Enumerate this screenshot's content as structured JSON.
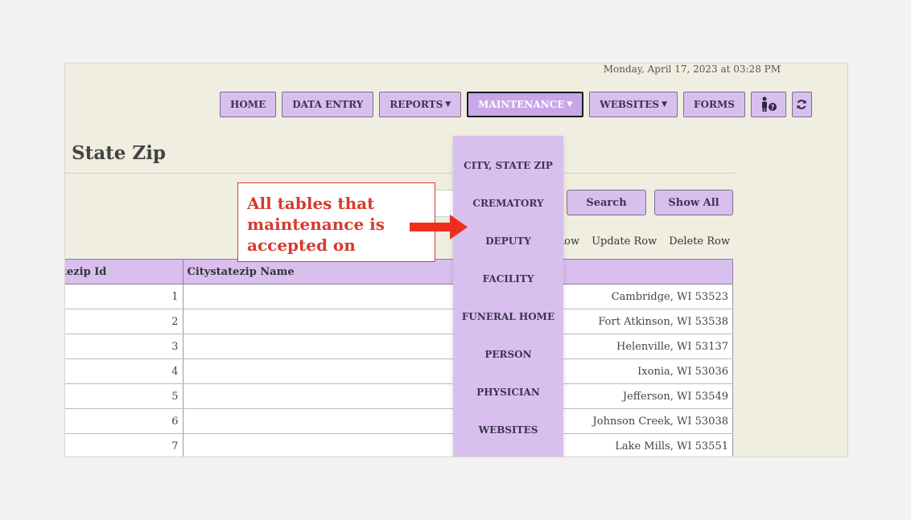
{
  "datetime": "Monday, April 17, 2023 at 03:28 PM",
  "nav": {
    "home": "HOME",
    "data_entry": "DATA ENTRY",
    "reports": "REPORTS",
    "maintenance": "MAINTENANCE",
    "websites": "WEBSITES",
    "forms": "FORMS",
    "help_icon": "person-help-icon",
    "refresh_icon": "refresh-icon",
    "caret_icon": "caret-down-icon"
  },
  "page": {
    "title": "State Zip"
  },
  "buttons": {
    "search": "Search",
    "show_all": "Show All"
  },
  "row_actions": [
    "Row",
    "Update Row",
    "Delete Row"
  ],
  "table": {
    "columns": [
      "tezip Id",
      "Citystatezip Name"
    ],
    "rows": [
      {
        "id": "1",
        "name": "Cambridge, WI 53523"
      },
      {
        "id": "2",
        "name": "Fort Atkinson, WI 53538"
      },
      {
        "id": "3",
        "name": "Helenville, WI 53137"
      },
      {
        "id": "4",
        "name": "Ixonia, WI 53036"
      },
      {
        "id": "5",
        "name": "Jefferson, WI 53549"
      },
      {
        "id": "6",
        "name": "Johnson Creek, WI 53038"
      },
      {
        "id": "7",
        "name": "Lake Mills, WI 53551"
      }
    ]
  },
  "dropdown": {
    "items": [
      "CITY, STATE ZIP",
      "CREMATORY",
      "DEPUTY",
      "FACILITY",
      "FUNERAL HOME",
      "PERSON",
      "PHYSICIAN",
      "WEBSITES"
    ]
  },
  "callout": {
    "text": "All tables that maintenance is accepted on"
  },
  "colors": {
    "accent": "#d9bfee",
    "callout": "#d63a2f",
    "background": "#f0eee1"
  }
}
